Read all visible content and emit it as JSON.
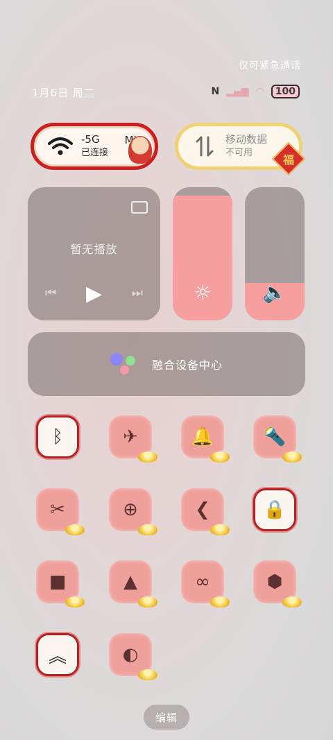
{
  "status": {
    "emergency_text": "仅可紧急通话",
    "date_text": "1月6日 周二",
    "battery": "100",
    "nfc_glyph": "N",
    "signal_glyph": "▂▄▆",
    "wifi_glyph": "◠"
  },
  "wifi_pill": {
    "name": "-5G",
    "suffix": "MI",
    "status": "已连接",
    "icon": "wifi-icon"
  },
  "data_pill": {
    "name": "移动数据",
    "status": "不可用",
    "badge": "福",
    "icon": "data-arrows-icon"
  },
  "media": {
    "no_play_text": "暂无播放",
    "prev_glyph": "⏮",
    "play_glyph": "▶",
    "next_glyph": "⏭"
  },
  "brightness": {
    "level": 0.94,
    "glyph": "☼"
  },
  "volume": {
    "level": 0.28,
    "glyph": "🔈"
  },
  "fusion": {
    "label": "融合设备中心"
  },
  "toggles": [
    {
      "name": "bluetooth",
      "glyph": "ᛒ",
      "active": true
    },
    {
      "name": "airplane",
      "glyph": "✈",
      "active": false
    },
    {
      "name": "bell",
      "glyph": "🔔",
      "active": false
    },
    {
      "name": "flashlight",
      "glyph": "🔦",
      "active": false
    },
    {
      "name": "screenshot",
      "glyph": "✂",
      "active": false
    },
    {
      "name": "battery-saver",
      "glyph": "⊕",
      "active": false
    },
    {
      "name": "shortcut",
      "glyph": "❮",
      "active": false
    },
    {
      "name": "rotation-lock",
      "glyph": "🔒",
      "active": true
    },
    {
      "name": "screen-record",
      "glyph": "■",
      "active": false
    },
    {
      "name": "screen-cast",
      "glyph": "▲",
      "active": false
    },
    {
      "name": "link",
      "glyph": "∞",
      "active": false
    },
    {
      "name": "settings",
      "glyph": "⬢",
      "active": false
    },
    {
      "name": "boost",
      "glyph": "︽",
      "active": true
    },
    {
      "name": "contrast",
      "glyph": "◐",
      "active": false
    }
  ],
  "edit_label": "编辑",
  "colors": {
    "tile_off": "#f0a09b",
    "tile_on_border": "#b52123",
    "slider_fill": "#f79f9f",
    "panel_bg": "#847a7a"
  }
}
